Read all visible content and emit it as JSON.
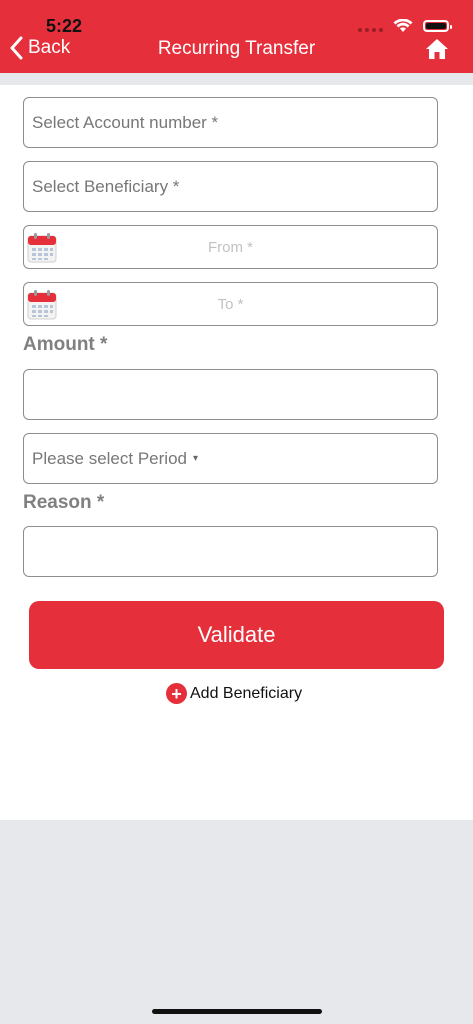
{
  "status_bar": {
    "time": "5:22"
  },
  "header": {
    "back_label": "Back",
    "title": "Recurring Transfer"
  },
  "form": {
    "account_placeholder": "Select Account number *",
    "beneficiary_placeholder": "Select Beneficiary *",
    "from_placeholder": "From *",
    "to_placeholder": "To *",
    "amount_label": "Amount *",
    "amount_value": "",
    "period_placeholder": "Please select Period",
    "period_caret": "▾",
    "reason_label": "Reason *",
    "reason_value": ""
  },
  "actions": {
    "validate_label": "Validate",
    "add_beneficiary_label": "Add Beneficiary",
    "add_icon_glyph": "+"
  },
  "colors": {
    "accent": "#e5303b",
    "background": "#e7e8ec"
  }
}
